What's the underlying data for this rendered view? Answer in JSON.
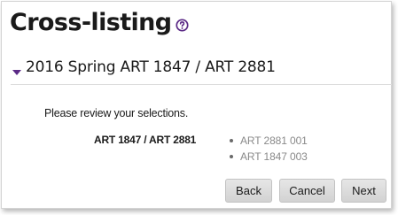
{
  "page": {
    "title": "Cross-listing",
    "help_icon": "question-circle-icon"
  },
  "section": {
    "toggle_icon": "caret-down-icon",
    "title": "2016 Spring ART 1847 / ART 2881"
  },
  "review": {
    "prompt": "Please review your selections.",
    "course_label": "ART 1847 / ART 2881",
    "sections": [
      "ART 2881 001",
      "ART 1847 003"
    ]
  },
  "buttons": {
    "back": "Back",
    "cancel": "Cancel",
    "next": "Next"
  },
  "colors": {
    "accent": "#5b2a86",
    "secondary_text": "#8a8a8a"
  }
}
